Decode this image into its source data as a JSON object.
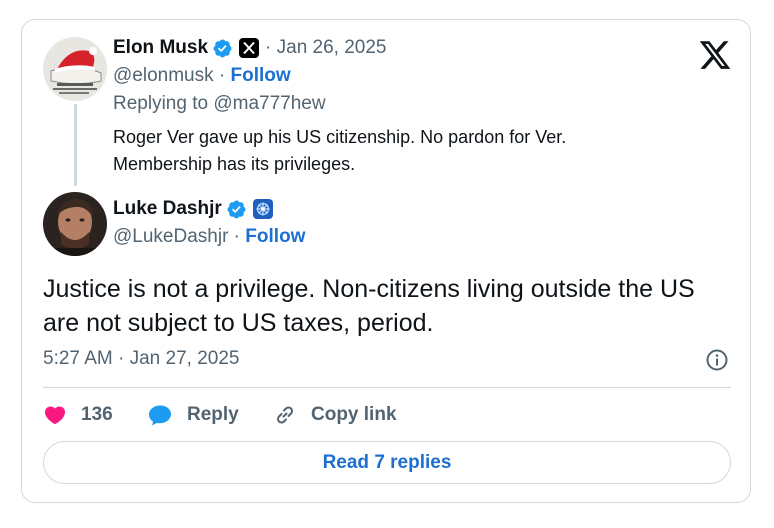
{
  "parent_tweet": {
    "author_name": "Elon Musk",
    "handle": "@elonmusk",
    "separator": " · ",
    "follow_label": "Follow",
    "date_text": "· Jan 26, 2025",
    "replying_to_prefix": "Replying to ",
    "replying_to_handle": "@ma777hew",
    "text_lines": [
      "Roger Ver gave up his US citizenship. No pardon for Ver.",
      "Membership has its privileges."
    ]
  },
  "main_tweet": {
    "author_name": "Luke Dashjr",
    "handle": "@LukeDashjr",
    "separator": " · ",
    "follow_label": "Follow",
    "text_lines": [
      "Justice is not a privilege. Non-citizens living outside the US",
      "are not subject to US taxes, period."
    ],
    "timestamp": "5:27 AM · Jan 27, 2025"
  },
  "actions": {
    "like_count": "136",
    "reply_label": "Reply",
    "copy_link_label": "Copy link"
  },
  "read_replies_label": "Read 7 replies",
  "icons": {
    "brand": "x-logo-icon",
    "verified": "verified-badge-icon",
    "like": "heart-icon",
    "reply": "speech-bubble-icon",
    "copy": "link-icon",
    "info": "info-icon"
  },
  "colors": {
    "verified_blue": "#1d9bf0",
    "follow_blue": "#1d6fd1",
    "like_pink": "#f91880",
    "muted_text": "#536471",
    "border": "#cfd9de"
  }
}
